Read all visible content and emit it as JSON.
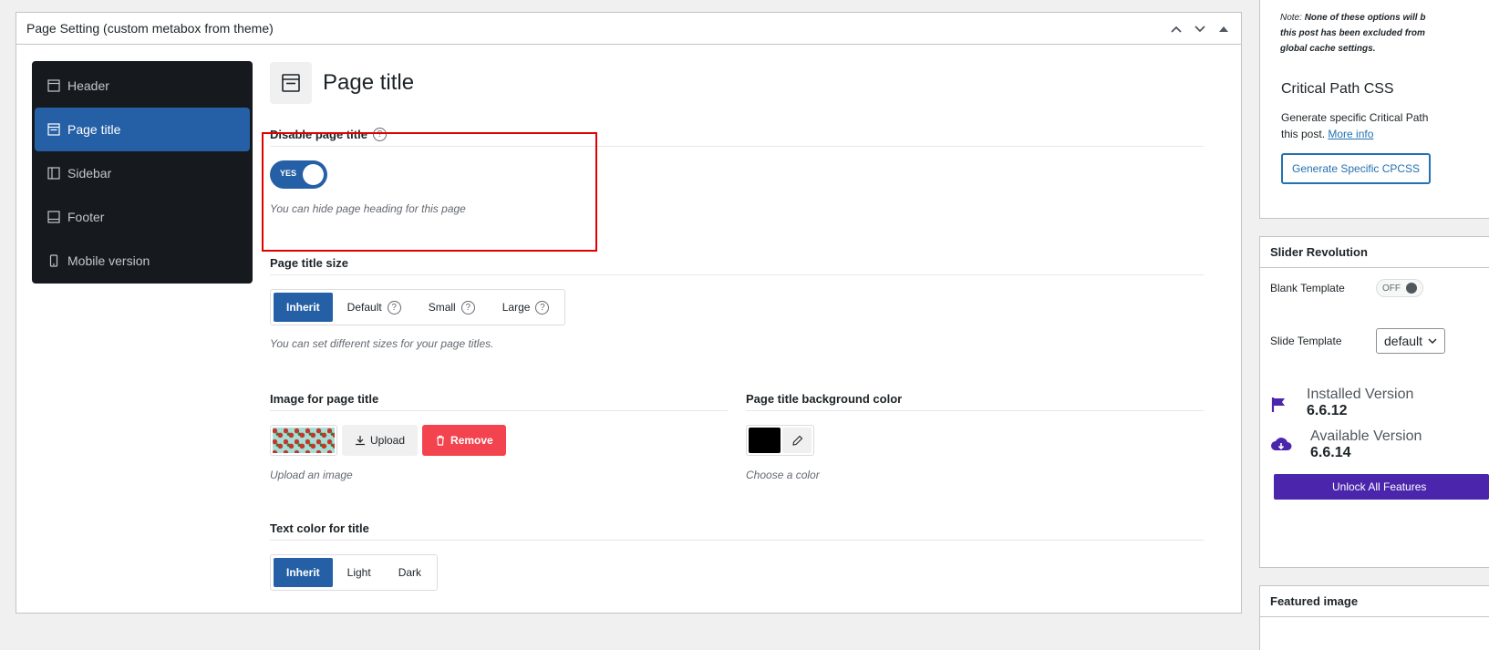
{
  "metabox": {
    "title": "Page Setting (custom metabox from theme)"
  },
  "nav": {
    "items": [
      {
        "label": "Header",
        "icon": "header-layout-icon"
      },
      {
        "label": "Page title",
        "icon": "page-title-layout-icon",
        "active": true
      },
      {
        "label": "Sidebar",
        "icon": "sidebar-layout-icon"
      },
      {
        "label": "Footer",
        "icon": "footer-layout-icon"
      },
      {
        "label": "Mobile version",
        "icon": "mobile-icon"
      }
    ]
  },
  "section": {
    "title": "Page title"
  },
  "disable_title": {
    "label": "Disable page title",
    "toggle_label": "YES",
    "help": "?",
    "description": "You can hide page heading for this page"
  },
  "title_size": {
    "label": "Page title size",
    "options": [
      "Inherit",
      "Default",
      "Small",
      "Large"
    ],
    "selected": "Inherit",
    "help": "?",
    "description": "You can set different sizes for your page titles."
  },
  "image": {
    "label": "Image for page title",
    "upload_label": "Upload",
    "remove_label": "Remove",
    "description": "Upload an image"
  },
  "bg_color": {
    "label": "Page title background color",
    "value": "#000000",
    "description": "Choose a color"
  },
  "text_color": {
    "label": "Text color for title",
    "options": [
      "Inherit",
      "Light",
      "Dark"
    ],
    "selected": "Inherit"
  },
  "cache_panel": {
    "note_lead": "Note:",
    "note_line1": "None of these options will b",
    "note_line2": "this post has been excluded from",
    "note_line3": "global cache settings.",
    "cpcss_title": "Critical Path CSS",
    "cpcss_text1": "Generate specific Critical Path",
    "cpcss_text2": "this post.",
    "more_info": "More info",
    "cpcss_button": "Generate Specific CPCSS"
  },
  "slider_panel": {
    "title": "Slider Revolution",
    "blank_template_label": "Blank Template",
    "blank_template_state": "OFF",
    "slide_template_label": "Slide Template",
    "slide_template_value": "default",
    "installed_label": "Installed Version",
    "installed_value": "6.6.12",
    "available_label": "Available Version",
    "available_value": "6.6.14",
    "unlock_button": "Unlock All Features"
  },
  "featured_panel": {
    "title": "Featured image"
  },
  "colors": {
    "accent": "#2560a6",
    "danger": "#f2434e",
    "highlight": "#e00000",
    "purple": "#4b25ab"
  }
}
